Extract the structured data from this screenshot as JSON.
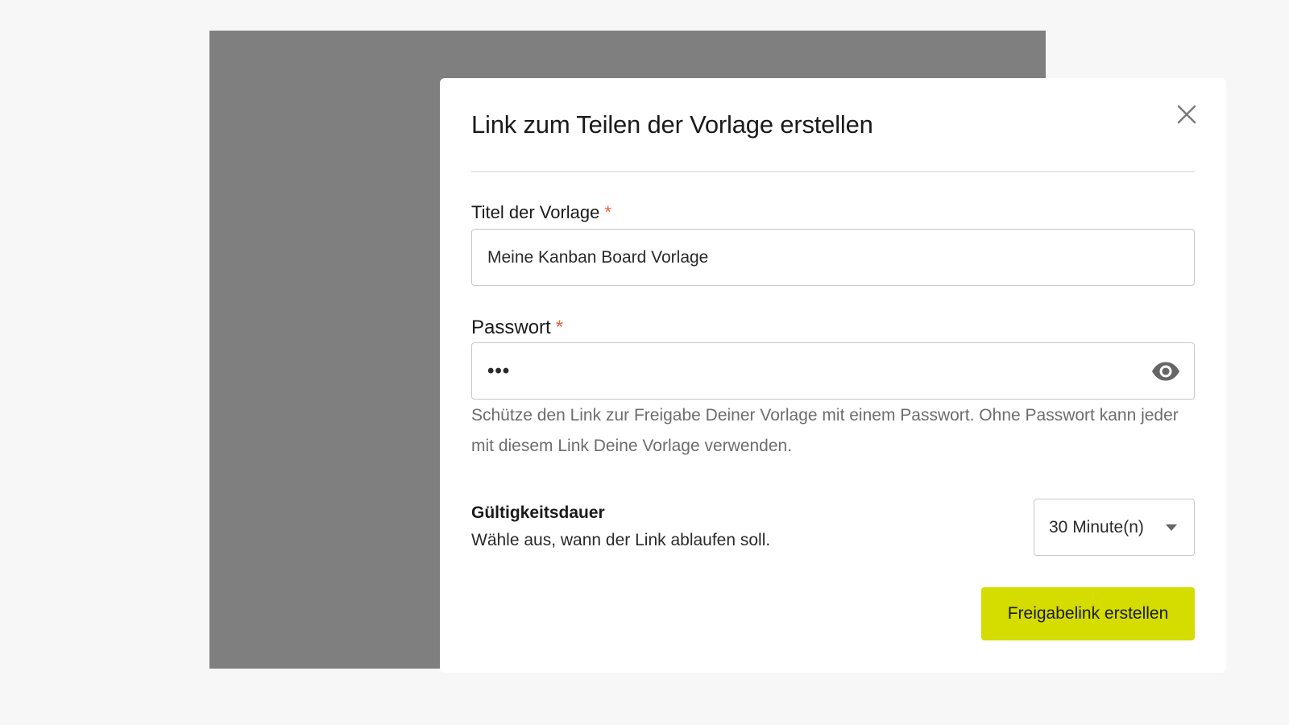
{
  "dialog": {
    "title": "Link zum Teilen der Vorlage erstellen"
  },
  "template_title": {
    "label": "Titel der Vorlage",
    "required_mark": "*",
    "value": "Meine Kanban Board Vorlage"
  },
  "password": {
    "label": "Passwort",
    "required_mark": "*",
    "masked_value": "•••",
    "toggle_icon": "eye-icon",
    "hint": "Schütze den Link zur Freigabe Deiner Vorlage mit einem Passwort. Ohne Passwort kann jeder mit diesem Link Deine Vorlage verwenden."
  },
  "validity": {
    "title": "Gültigkeitsdauer",
    "description": "Wähle aus, wann der Link ablaufen soll.",
    "selected": "30 Minute(n)"
  },
  "actions": {
    "create_label": "Freigabelink erstellen"
  },
  "colors": {
    "primary": "#d4dc00",
    "required": "#e8663d",
    "backdrop": "#7f7f7f"
  }
}
